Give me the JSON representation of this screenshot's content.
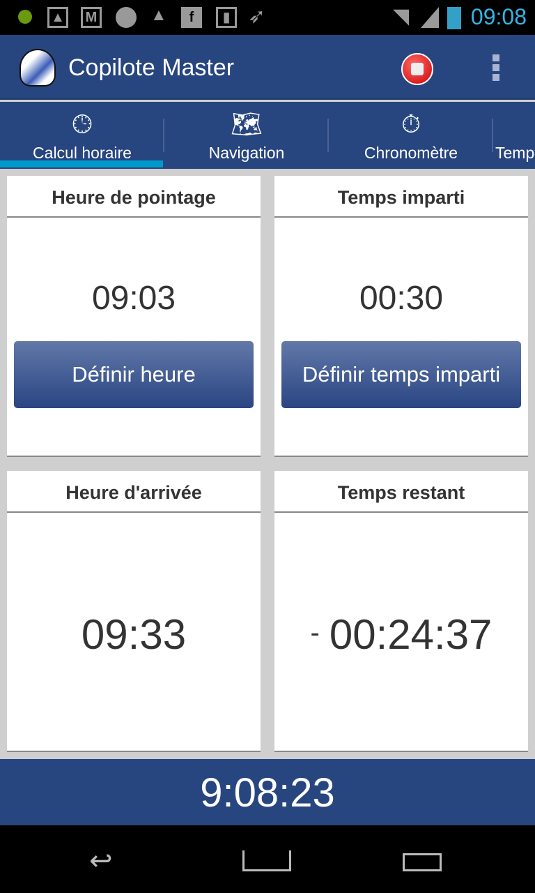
{
  "status_bar": {
    "time": "09:08",
    "icons": [
      "notification-dot-icon",
      "image-icon",
      "gmail-icon",
      "ball-icon",
      "bell-icon",
      "facebook-icon",
      "chart-icon",
      "rocket-icon",
      "wifi-icon",
      "signal-icon",
      "battery-icon"
    ]
  },
  "app_bar": {
    "title": "Copilote Master",
    "actions": [
      "record-stop-icon",
      "overflow-menu-icon"
    ]
  },
  "tabs": [
    {
      "label": "Calcul horaire",
      "icon": "clock-icon",
      "selected": true
    },
    {
      "label": "Navigation",
      "icon": "map-icon"
    },
    {
      "label": "Chronomètre",
      "icon": "stopwatch-icon"
    },
    {
      "label": "Temp"
    }
  ],
  "colors": {
    "primary": "#27457f",
    "tab_indicator": "#0099cc",
    "clock": "#33b5e5"
  },
  "cards": {
    "pointage": {
      "title": "Heure de pointage",
      "value": "09:03",
      "button": "Définir heure"
    },
    "imparti": {
      "title": "Temps imparti",
      "value": "00:30",
      "button": "Définir temps imparti"
    },
    "arrivee": {
      "title": "Heure d'arrivée",
      "value": "09:33"
    },
    "restant": {
      "title": "Temps restant",
      "sign": "-",
      "value": "00:24:37"
    }
  },
  "footer": {
    "current_time": "9:08:23"
  }
}
